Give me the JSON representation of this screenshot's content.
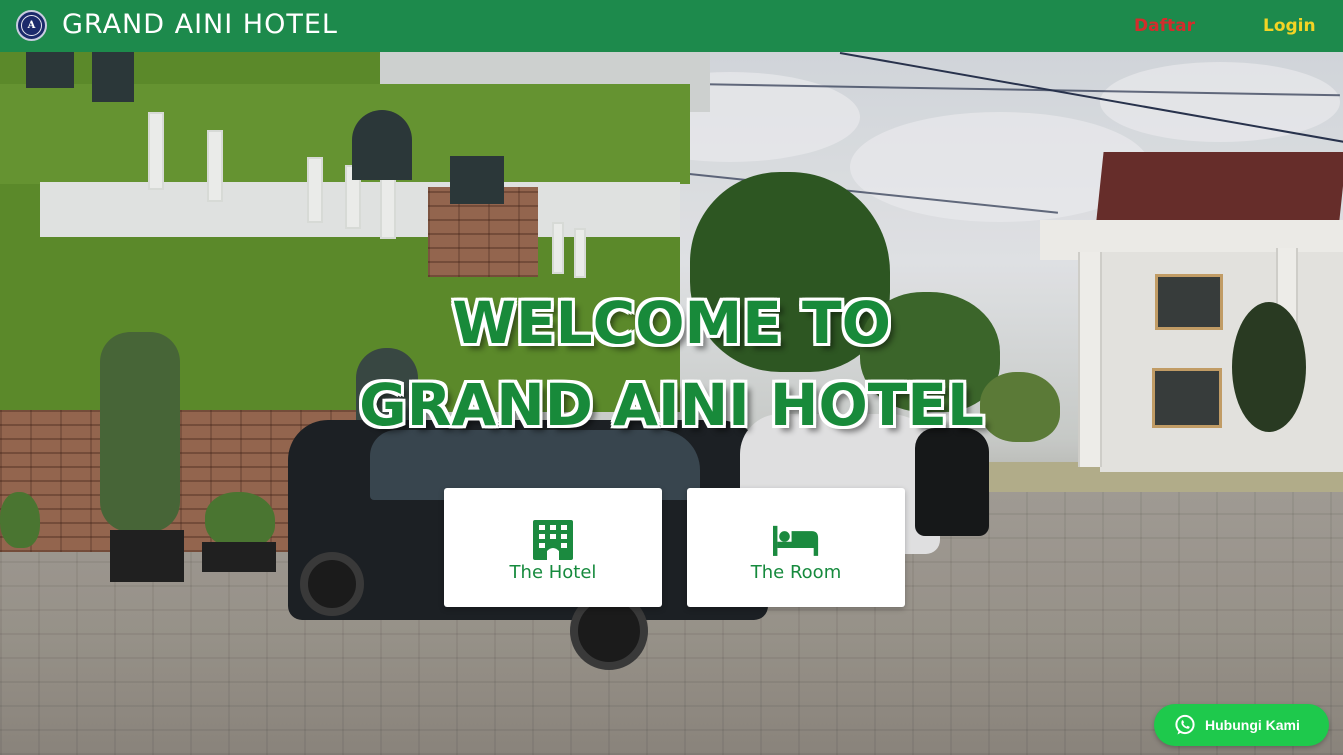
{
  "navbar": {
    "brand": "GRAND AINI HOTEL",
    "logo_icon": "hotel-emblem-icon",
    "logo_letter": "A",
    "links": [
      {
        "label": "Daftar",
        "color": "#d32c2c"
      },
      {
        "label": "Login",
        "color": "#f3d425"
      }
    ],
    "background": "#1d8a4c"
  },
  "hero": {
    "title_line1": "WELCOME TO",
    "title_line2": "GRAND AINI HOTEL",
    "title_color": "#188a3a"
  },
  "cards": [
    {
      "label": "The Hotel",
      "icon": "hotel-building-icon"
    },
    {
      "label": "The Room",
      "icon": "bed-icon"
    }
  ],
  "contact": {
    "label": "Hubungi Kami",
    "icon": "whatsapp-icon",
    "color": "#1ec94c"
  }
}
